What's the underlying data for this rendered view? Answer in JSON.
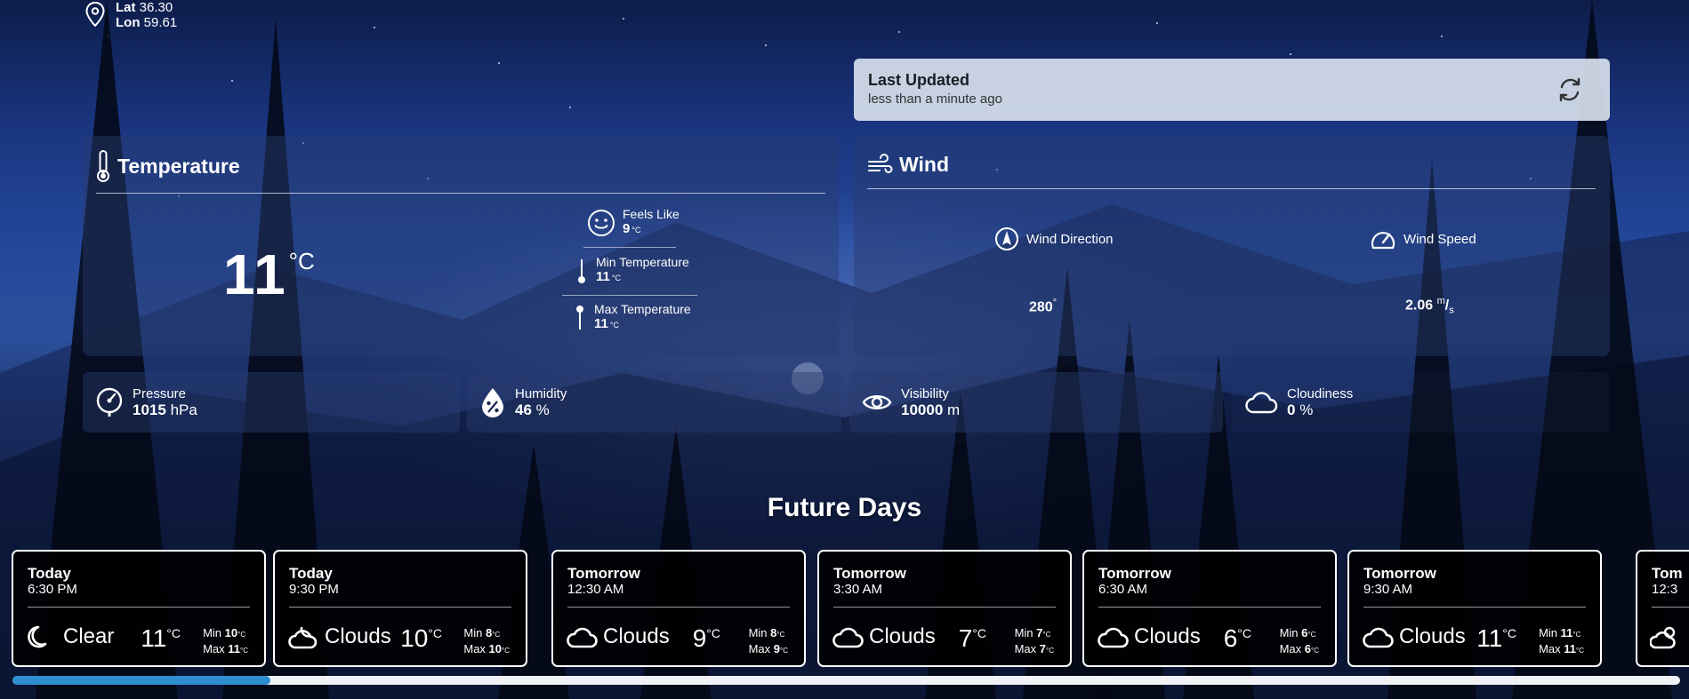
{
  "location": {
    "lat_label": "Lat",
    "lat_value": "36.30",
    "lon_label": "Lon",
    "lon_value": "59.61"
  },
  "last_updated": {
    "title": "Last Updated",
    "subtitle": "less than a minute ago"
  },
  "temperature": {
    "title": "Temperature",
    "current": "11",
    "unit": "°C",
    "feels_like_label": "Feels Like",
    "feels_like_value": "9",
    "min_label": "Min Temperature",
    "min_value": "11",
    "max_label": "Max Temperature",
    "max_value": "11",
    "small_unit": "°C"
  },
  "wind": {
    "title": "Wind",
    "direction_label": "Wind Direction",
    "direction_value": "280",
    "direction_unit": "°",
    "speed_label": "Wind Speed",
    "speed_value": "2.06",
    "speed_unit_top": "m",
    "speed_unit_bottom": "s"
  },
  "metrics": [
    {
      "label": "Pressure",
      "value": "1015",
      "unit": "hPa"
    },
    {
      "label": "Humidity",
      "value": "46",
      "unit": "%"
    },
    {
      "label": "Visibility",
      "value": "10000",
      "unit": "m"
    },
    {
      "label": "Cloudiness",
      "value": "0",
      "unit": "%"
    }
  ],
  "future": {
    "title": "Future Days",
    "cards": [
      {
        "day": "Today",
        "time": "6:30 PM",
        "condition": "Clear",
        "icon": "moon-icon",
        "temp": "11",
        "min": "10",
        "max": "11"
      },
      {
        "day": "Today",
        "time": "9:30 PM",
        "condition": "Clouds",
        "icon": "cloud-moon-icon",
        "temp": "10",
        "min": "8",
        "max": "10"
      },
      {
        "day": "Tomorrow",
        "time": "12:30 AM",
        "condition": "Clouds",
        "icon": "cloud-icon",
        "temp": "9",
        "min": "8",
        "max": "9"
      },
      {
        "day": "Tomorrow",
        "time": "3:30 AM",
        "condition": "Clouds",
        "icon": "cloud-icon",
        "temp": "7",
        "min": "7",
        "max": "7"
      },
      {
        "day": "Tomorrow",
        "time": "6:30 AM",
        "condition": "Clouds",
        "icon": "cloud-icon",
        "temp": "6",
        "min": "6",
        "max": "6"
      },
      {
        "day": "Tomorrow",
        "time": "9:30 AM",
        "condition": "Clouds",
        "icon": "cloud-icon",
        "temp": "11",
        "min": "11",
        "max": "11"
      },
      {
        "day": "Tom",
        "time": "12:3",
        "condition": "",
        "icon": "cloud-sun-icon",
        "temp": "",
        "min": "",
        "max": ""
      }
    ],
    "labels": {
      "min": "Min",
      "max": "Max",
      "unit": "°C"
    }
  },
  "colors": {
    "scroll_thumb": "#2f8ed0",
    "last_updated_bg": "#d7e0eb"
  }
}
